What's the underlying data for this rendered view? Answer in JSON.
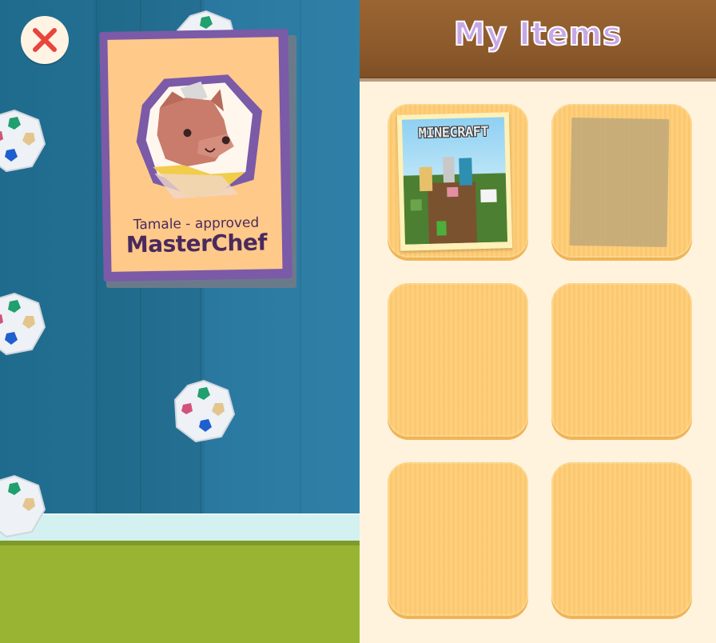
{
  "panel": {
    "title": "My Items"
  },
  "poster": {
    "line1": "Tamale - approved",
    "line2": "MasterChef"
  },
  "inventory": {
    "slots": [
      {
        "state": "filled",
        "item_title": "MINECRAFT"
      },
      {
        "state": "placeholder"
      },
      {
        "state": "empty"
      },
      {
        "state": "empty"
      },
      {
        "state": "empty"
      },
      {
        "state": "empty"
      }
    ]
  },
  "colors": {
    "wall": "#236f91",
    "floor": "#98b432",
    "panel_bg": "#fff3de",
    "header": "#8d5a2c",
    "slot": "#ffcc73",
    "title": "#c7a7e6",
    "poster_frame": "#7b5aa8"
  },
  "icons": {
    "close": "close-x-icon",
    "palette": "paint-palette-icon"
  }
}
